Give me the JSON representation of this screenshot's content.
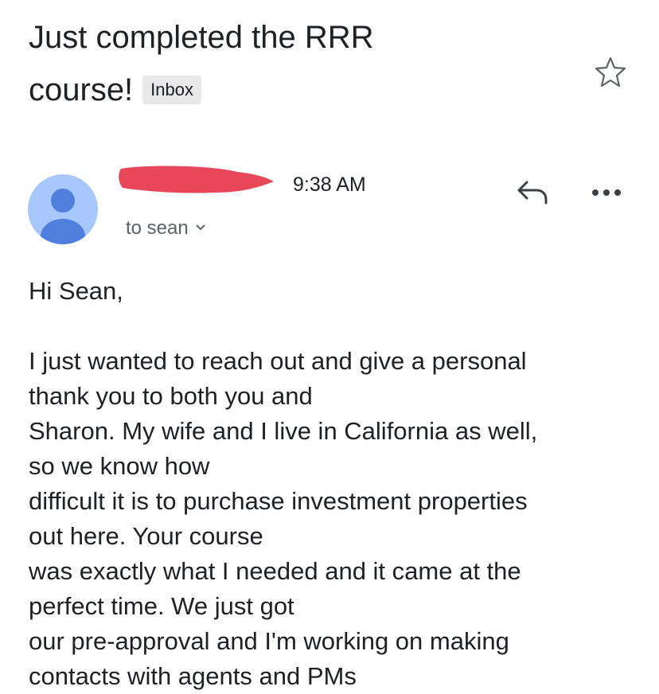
{
  "email": {
    "subject": "Just completed the RRR",
    "subject_line2": "course!",
    "label": "Inbox",
    "time": "9:38 AM",
    "recipient": "to sean",
    "greeting": "Hi Sean,",
    "body_lines": [
      "I just wanted to reach out and give a personal",
      "thank you to both you and",
      "Sharon. My wife and I live in California as well,",
      "so we know how",
      "difficult it is to purchase investment properties",
      "out here. Your course",
      "was exactly what I needed and it came at the",
      "perfect time. We just got",
      "our pre-approval and I'm working on making",
      "contacts with agents and PMs"
    ]
  },
  "icons": {
    "star": "star-outline-icon",
    "reply": "reply-icon",
    "more": "more-horizontal-icon",
    "chevron": "chevron-down-icon",
    "avatar": "default-avatar-icon"
  },
  "colors": {
    "avatar_bg": "#a8c7fa",
    "avatar_fg": "#4f7fdc",
    "redaction": "#e8475a",
    "label_bg": "#e8e8e8"
  }
}
